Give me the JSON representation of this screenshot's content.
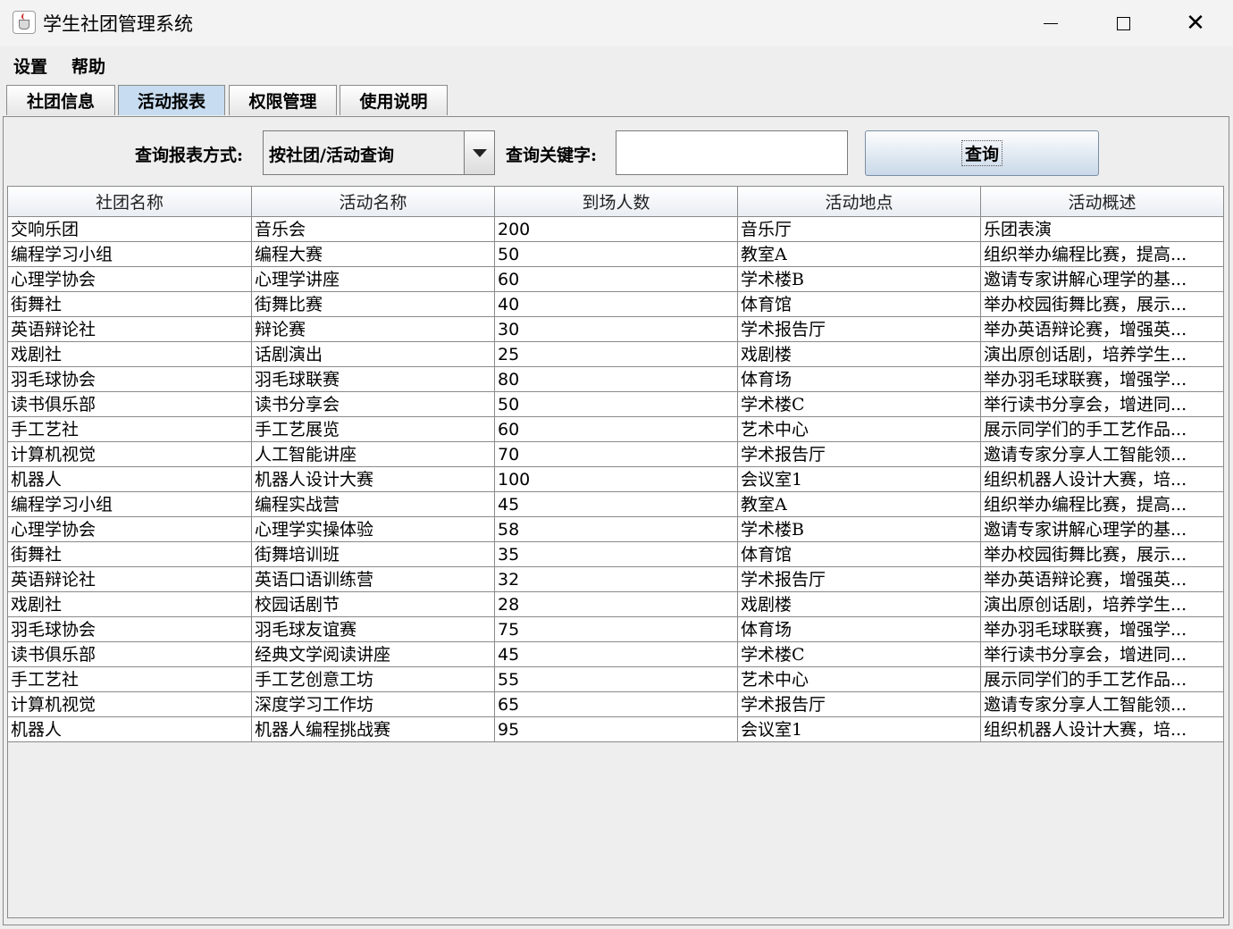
{
  "window": {
    "title": "学生社团管理系统",
    "minimize_glyph": "─",
    "close_glyph": "✕"
  },
  "menu": [
    "设置",
    "帮助"
  ],
  "tabs": [
    {
      "label": "社团信息"
    },
    {
      "label": "活动报表",
      "active": true
    },
    {
      "label": "权限管理"
    },
    {
      "label": "使用说明"
    }
  ],
  "query": {
    "mode_label": "查询报表方式:",
    "mode_value": "按社团/活动查询",
    "keyword_label": "查询关键字:",
    "keyword_value": "",
    "button_label": "查询"
  },
  "table": {
    "columns": [
      "社团名称",
      "活动名称",
      "到场人数",
      "活动地点",
      "活动概述"
    ],
    "rows": [
      [
        "交响乐团",
        "音乐会",
        "200",
        "音乐厅",
        "乐团表演"
      ],
      [
        "编程学习小组",
        "编程大赛",
        "50",
        "教室A",
        "组织举办编程比赛，提高..."
      ],
      [
        "心理学协会",
        "心理学讲座",
        "60",
        "学术楼B",
        "邀请专家讲解心理学的基..."
      ],
      [
        "街舞社",
        "街舞比赛",
        "40",
        "体育馆",
        "举办校园街舞比赛，展示..."
      ],
      [
        "英语辩论社",
        "辩论赛",
        "30",
        "学术报告厅",
        "举办英语辩论赛，增强英..."
      ],
      [
        "戏剧社",
        "话剧演出",
        "25",
        "戏剧楼",
        "演出原创话剧，培养学生..."
      ],
      [
        "羽毛球协会",
        "羽毛球联赛",
        "80",
        "体育场",
        "举办羽毛球联赛，增强学..."
      ],
      [
        "读书俱乐部",
        "读书分享会",
        "50",
        "学术楼C",
        "举行读书分享会，增进同..."
      ],
      [
        "手工艺社",
        "手工艺展览",
        "60",
        "艺术中心",
        "展示同学们的手工艺作品..."
      ],
      [
        "计算机视觉",
        "人工智能讲座",
        "70",
        "学术报告厅",
        "邀请专家分享人工智能领..."
      ],
      [
        "机器人",
        "机器人设计大赛",
        "100",
        "会议室1",
        "组织机器人设计大赛，培..."
      ],
      [
        "编程学习小组",
        "编程实战营",
        "45",
        "教室A",
        "组织举办编程比赛，提高..."
      ],
      [
        "心理学协会",
        "心理学实操体验",
        "58",
        "学术楼B",
        "邀请专家讲解心理学的基..."
      ],
      [
        "街舞社",
        "街舞培训班",
        "35",
        "体育馆",
        "举办校园街舞比赛，展示..."
      ],
      [
        "英语辩论社",
        "英语口语训练营",
        "32",
        "学术报告厅",
        "举办英语辩论赛，增强英..."
      ],
      [
        "戏剧社",
        "校园话剧节",
        "28",
        "戏剧楼",
        "演出原创话剧，培养学生..."
      ],
      [
        "羽毛球协会",
        "羽毛球友谊赛",
        "75",
        "体育场",
        "举办羽毛球联赛，增强学..."
      ],
      [
        "读书俱乐部",
        "经典文学阅读讲座",
        "45",
        "学术楼C",
        "举行读书分享会，增进同..."
      ],
      [
        "手工艺社",
        "手工艺创意工坊",
        "55",
        "艺术中心",
        "展示同学们的手工艺作品..."
      ],
      [
        "计算机视觉",
        "深度学习工作坊",
        "65",
        "学术报告厅",
        "邀请专家分享人工智能领..."
      ],
      [
        "机器人",
        "机器人编程挑战赛",
        "95",
        "会议室1",
        "组织机器人设计大赛，培..."
      ]
    ]
  }
}
